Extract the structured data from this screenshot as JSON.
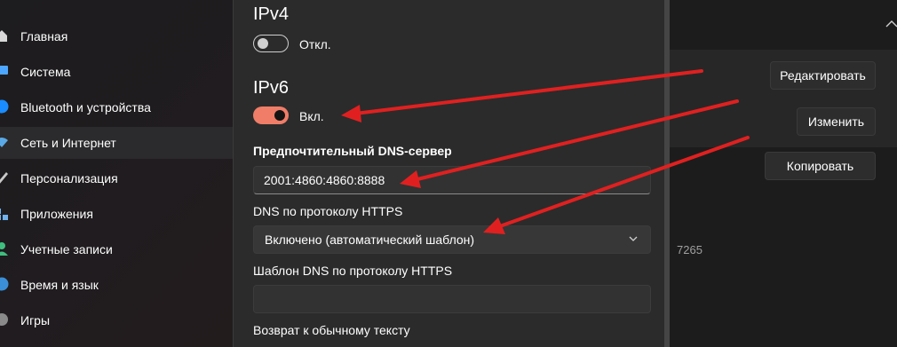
{
  "sidebar": {
    "items": [
      {
        "label": "Главная",
        "icon": "home-icon"
      },
      {
        "label": "Система",
        "icon": "monitor-icon"
      },
      {
        "label": "Bluetooth и устройства",
        "icon": "bluetooth-icon"
      },
      {
        "label": "Сеть и Интернет",
        "icon": "wifi-icon"
      },
      {
        "label": "Персонализация",
        "icon": "brush-icon"
      },
      {
        "label": "Приложения",
        "icon": "apps-icon"
      },
      {
        "label": "Учетные записи",
        "icon": "account-icon"
      },
      {
        "label": "Время и язык",
        "icon": "globe-icon"
      },
      {
        "label": "Игры",
        "icon": "game-icon"
      }
    ]
  },
  "background": {
    "edit_button": "Редактировать",
    "change_button": "Изменить",
    "copy_button": "Копировать",
    "partial_value": "7265"
  },
  "dialog": {
    "ipv4": {
      "heading": "IPv4",
      "toggle_label": "Откл.",
      "enabled": false
    },
    "ipv6": {
      "heading": "IPv6",
      "toggle_label": "Вкл.",
      "enabled": true
    },
    "preferred_dns_label": "Предпочтительный DNS-сервер",
    "preferred_dns_value": "2001:4860:4860:8888",
    "doh_label": "DNS по протоколу HTTPS",
    "doh_selected": "Включено (автоматический шаблон)",
    "doh_template_label": "Шаблон DNS по протоколу HTTPS",
    "doh_template_value": "",
    "fallback_label": "Возврат к обычному тексту"
  },
  "colors": {
    "toggle_on": "#ef7d68",
    "arrow": "#e02020",
    "dialog_bg": "#2b2b2b"
  }
}
